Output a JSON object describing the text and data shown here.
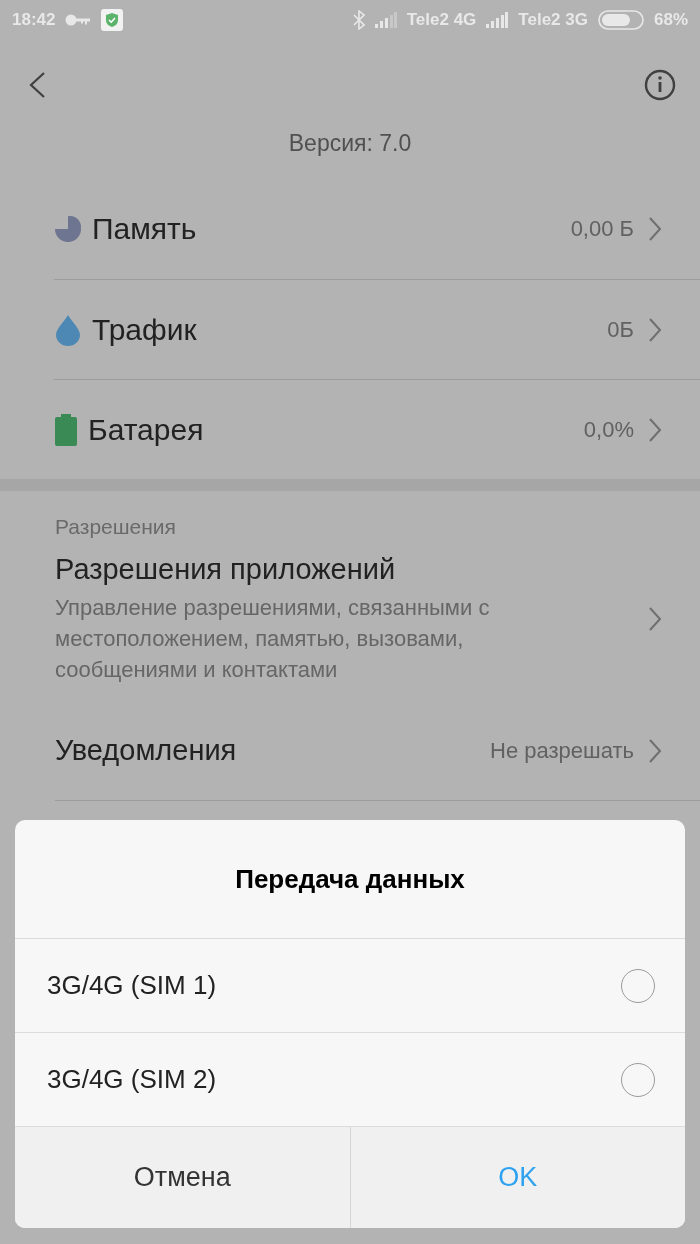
{
  "status_bar": {
    "time": "18:42",
    "carrier_1": "Tele2 4G",
    "carrier_2": "Tele2 3G",
    "battery": "68%"
  },
  "header": {
    "version": "Версия: 7.0"
  },
  "usage_rows": [
    {
      "kind": "storage",
      "label": "Память",
      "value": "0,00 Б",
      "color": "#6e7590"
    },
    {
      "kind": "traffic",
      "label": "Трафик",
      "value": "0Б",
      "color": "#4d88b4"
    },
    {
      "kind": "battery",
      "label": "Батарея",
      "value": "0,0%",
      "color": "#3a8a55"
    }
  ],
  "permissions": {
    "section_title": "Разрешения",
    "app_permissions": {
      "title": "Разрешения приложений",
      "description": "Управление разрешениями, связанными с местоположением, памятью, вызовами, сообщениями и контактами"
    },
    "notifications": {
      "title": "Уведомления",
      "value": "Не разрешать"
    }
  },
  "dialog": {
    "title": "Передача данных",
    "options": [
      {
        "label": "3G/4G (SIM 1)",
        "selected": false
      },
      {
        "label": "3G/4G (SIM 2)",
        "selected": false
      }
    ],
    "cancel": "Отмена",
    "ok": "OK"
  }
}
